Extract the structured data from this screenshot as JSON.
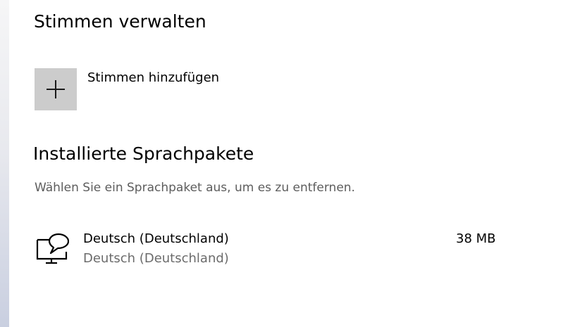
{
  "voices_section": {
    "title": "Stimmen verwalten",
    "add_label": "Stimmen hinzufügen",
    "add_icon": "plus-icon"
  },
  "packs_section": {
    "title": "Installierte Sprachpakete",
    "hint": "Wählen Sie ein Sprachpaket aus, um es zu entfernen.",
    "items": [
      {
        "name": "Deutsch (Deutschland)",
        "subtitle": "Deutsch (Deutschland)",
        "size": "38 MB",
        "icon": "speech-monitor-icon"
      }
    ]
  },
  "colors": {
    "tile_background": "#cccccc",
    "secondary_text": "#6b6b6b"
  }
}
